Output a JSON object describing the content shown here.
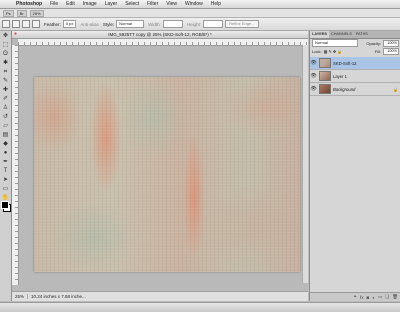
{
  "menubar": {
    "apple": "",
    "items": [
      "Photoshop",
      "File",
      "Edit",
      "Image",
      "Layer",
      "Select",
      "Filter",
      "View",
      "Window",
      "Help"
    ]
  },
  "optionsbar": {
    "feather_label": "Feather:",
    "feather_value": "0 px",
    "anti_alias": "Anti-alias",
    "style_label": "Style:",
    "style_value": "Normal",
    "width_label": "Width:",
    "height_label": "Height:",
    "refine_edge": "Refine Edge..."
  },
  "document": {
    "title": "IMG_5925TT copy @ 25% (SKD-Soft-12, RGB/8*) *",
    "zoom": "25%",
    "info": "10.24 inches x 7.68 inche...",
    "appbar_zoom": "25%"
  },
  "layers_panel": {
    "tabs": [
      "LAYERS",
      "CHANNELS",
      "PATHS"
    ],
    "blend_mode": "Normal",
    "opacity_label": "Opacity:",
    "opacity_value": "100%",
    "lock_label": "Lock:",
    "fill_label": "Fill:",
    "fill_value": "100%",
    "layers": [
      {
        "name": "SKD-Soft-12",
        "selected": true
      },
      {
        "name": "Layer 1",
        "selected": false
      },
      {
        "name": "Background",
        "selected": false
      }
    ]
  },
  "colors": {
    "selection": "#a9c4e4",
    "menubar": "#e8e8e8",
    "workspace": "#b9b9b9"
  }
}
